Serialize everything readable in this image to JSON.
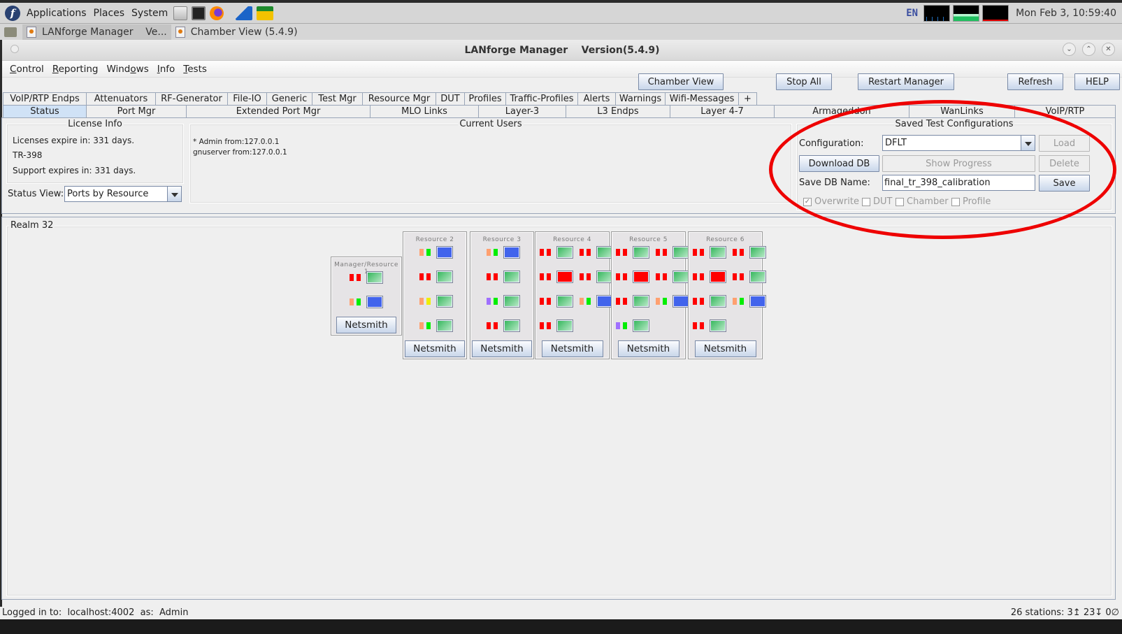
{
  "desktop": {
    "menu": [
      "Applications",
      "Places",
      "System"
    ],
    "launchers": [
      "files-icon",
      "terminal-icon",
      "firefox-icon",
      "wireshark-icon",
      "lanforge-gui-icon"
    ],
    "keyboard_layout": "EN",
    "clock": "Mon Feb  3, 10:59:40"
  },
  "taskbar": {
    "items": [
      {
        "label": "LANforge Manager    Ve...",
        "active": true
      },
      {
        "label": "Chamber View (5.4.9)",
        "active": false
      }
    ]
  },
  "window": {
    "title": "LANforge Manager    Version(5.4.9)"
  },
  "menubar": {
    "items": [
      {
        "pre": "",
        "mnemonic": "C",
        "post": "ontrol"
      },
      {
        "pre": "",
        "mnemonic": "R",
        "post": "eporting"
      },
      {
        "pre": "Wind",
        "mnemonic": "o",
        "post": "ws"
      },
      {
        "pre": "",
        "mnemonic": "I",
        "post": "nfo"
      },
      {
        "pre": "",
        "mnemonic": "T",
        "post": "ests"
      }
    ]
  },
  "toolbar": {
    "chamber_view": "Chamber View",
    "stop_all": "Stop All",
    "restart_manager": "Restart Manager",
    "refresh": "Refresh",
    "help": "HELP"
  },
  "tabs_row1": [
    "VoIP/RTP Endps",
    "Attenuators",
    "RF-Generator",
    "File-IO",
    "Generic",
    "Test Mgr",
    "Resource Mgr",
    "DUT",
    "Profiles",
    "Traffic-Profiles",
    "Alerts",
    "Warnings",
    "Wifi-Messages",
    "+"
  ],
  "tabs_row2": [
    "Status",
    "Port Mgr",
    "Extended Port Mgr",
    "MLO Links",
    "Layer-3",
    "L3 Endps",
    "Layer 4-7",
    "Armageddon",
    "WanLinks",
    "VoIP/RTP"
  ],
  "selected_tab": "Status",
  "license_info": {
    "title": "License Info",
    "lines": [
      "Licenses expire in: 331 days.",
      "TR-398",
      "Support expires in: 331 days."
    ]
  },
  "status_view": {
    "label": "Status View:",
    "value": "Ports by Resource"
  },
  "current_users": {
    "title": "Current Users",
    "users": [
      "* Admin from:127.0.0.1",
      "gnuserver from:127.0.0.1"
    ]
  },
  "saved_configs": {
    "title": "Saved Test Configurations",
    "configuration_label": "Configuration:",
    "configuration_value": "DFLT",
    "load": "Load",
    "download_db": "Download DB",
    "show_progress": "Show Progress",
    "delete": "Delete",
    "save_db_name_label": "Save DB Name:",
    "save_db_name_value": "final_tr_398_calibration",
    "save": "Save",
    "checkboxes": [
      {
        "label": "Overwrite",
        "checked": true
      },
      {
        "label": "DUT",
        "checked": false
      },
      {
        "label": "Chamber",
        "checked": false
      },
      {
        "label": "Profile",
        "checked": false
      }
    ]
  },
  "realm": {
    "title": "Realm 32",
    "colors": {
      "red": "#ff0000",
      "orange": "#ffa070",
      "green": "#00ee00",
      "yellow": "#eeee00",
      "purple": "#a070ff",
      "port_up": "#2fb457",
      "port_blue": "#4264ec",
      "port_down": "#ff0000"
    },
    "resources": [
      {
        "name": "Manager/Resource 1",
        "netsmith": "Netsmith",
        "ports": [
          [
            {
              "leds": [
                "red",
                "red"
              ],
              "port": "up"
            }
          ],
          [
            {
              "leds": [
                "orange",
                "green"
              ],
              "port": "blue"
            }
          ]
        ]
      },
      {
        "name": "Resource 2",
        "netsmith": "Netsmith",
        "ports": [
          [
            {
              "leds": [
                "orange",
                "green"
              ],
              "port": "blue"
            }
          ],
          [
            {
              "leds": [
                "red",
                "red"
              ],
              "port": "up"
            }
          ],
          [
            {
              "leds": [
                "orange",
                "yellow"
              ],
              "port": "up"
            }
          ],
          [
            {
              "leds": [
                "orange",
                "green"
              ],
              "port": "up"
            }
          ]
        ]
      },
      {
        "name": "Resource 3",
        "netsmith": "Netsmith",
        "ports": [
          [
            {
              "leds": [
                "orange",
                "green"
              ],
              "port": "blue"
            }
          ],
          [
            {
              "leds": [
                "red",
                "red"
              ],
              "port": "up"
            }
          ],
          [
            {
              "leds": [
                "purple",
                "green"
              ],
              "port": "up"
            }
          ],
          [
            {
              "leds": [
                "red",
                "red"
              ],
              "port": "up"
            }
          ]
        ]
      },
      {
        "name": "Resource 4",
        "netsmith": "Netsmith",
        "ports": [
          [
            {
              "leds": [
                "red",
                "red"
              ],
              "port": "up"
            },
            {
              "leds": [
                "red",
                "red"
              ],
              "port": "up"
            }
          ],
          [
            {
              "leds": [
                "red",
                "red"
              ],
              "port": "red"
            },
            {
              "leds": [
                "red",
                "red"
              ],
              "port": "up"
            }
          ],
          [
            {
              "leds": [
                "red",
                "red"
              ],
              "port": "up"
            },
            {
              "leds": [
                "orange",
                "green"
              ],
              "port": "blue"
            }
          ],
          [
            {
              "leds": [
                "red",
                "red"
              ],
              "port": "up"
            }
          ]
        ]
      },
      {
        "name": "Resource 5",
        "netsmith": "Netsmith",
        "ports": [
          [
            {
              "leds": [
                "red",
                "red"
              ],
              "port": "up"
            },
            {
              "leds": [
                "red",
                "red"
              ],
              "port": "up"
            }
          ],
          [
            {
              "leds": [
                "red",
                "red"
              ],
              "port": "red"
            },
            {
              "leds": [
                "red",
                "red"
              ],
              "port": "up"
            }
          ],
          [
            {
              "leds": [
                "red",
                "red"
              ],
              "port": "up"
            },
            {
              "leds": [
                "orange",
                "green"
              ],
              "port": "blue"
            }
          ],
          [
            {
              "leds": [
                "purple",
                "green"
              ],
              "port": "up"
            }
          ]
        ]
      },
      {
        "name": "Resource 6",
        "netsmith": "Netsmith",
        "ports": [
          [
            {
              "leds": [
                "red",
                "red"
              ],
              "port": "up"
            },
            {
              "leds": [
                "red",
                "red"
              ],
              "port": "up"
            }
          ],
          [
            {
              "leds": [
                "red",
                "red"
              ],
              "port": "red"
            },
            {
              "leds": [
                "red",
                "red"
              ],
              "port": "up"
            }
          ],
          [
            {
              "leds": [
                "red",
                "red"
              ],
              "port": "up"
            },
            {
              "leds": [
                "orange",
                "green"
              ],
              "port": "blue"
            }
          ],
          [
            {
              "leds": [
                "red",
                "red"
              ],
              "port": "up"
            }
          ]
        ]
      }
    ]
  },
  "statusbar": {
    "left": "Logged in to:  localhost:4002  as:  Admin",
    "right": "26 stations: 3↥ 23↧ 0∅"
  }
}
